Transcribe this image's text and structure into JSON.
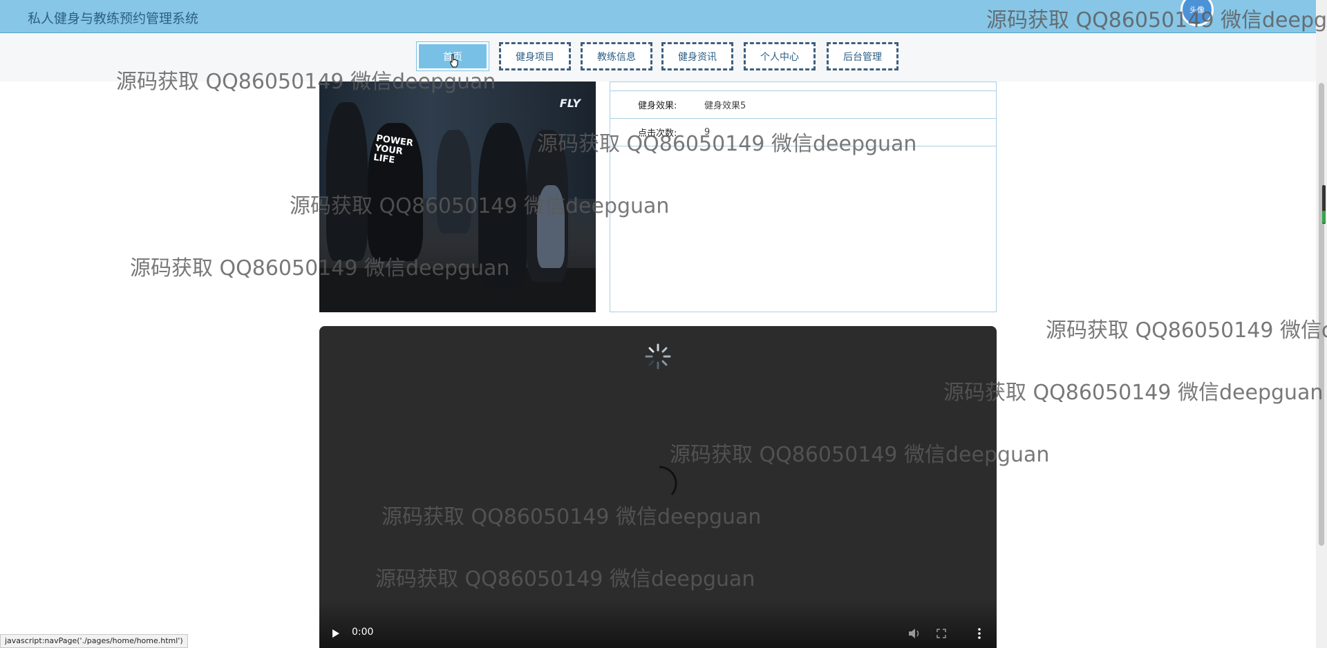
{
  "header": {
    "app_title": "私人健身与教练预约管理系统",
    "avatar_label": "头像"
  },
  "nav": {
    "items": [
      {
        "label": "首页",
        "active": true
      },
      {
        "label": "健身项目"
      },
      {
        "label": "教练信息"
      },
      {
        "label": "健身资讯"
      },
      {
        "label": "个人中心"
      },
      {
        "label": "后台管理"
      }
    ]
  },
  "detail": {
    "photo_logo": "FLY",
    "photo_shirt": "POWER YOUR LIFE",
    "fields": [
      {
        "label": "健身效果:",
        "value": "健身效果5"
      },
      {
        "label": "点击次数:",
        "value": "9"
      }
    ]
  },
  "video": {
    "time": "0:00"
  },
  "status_bar": "javascript:navPage('./pages/home/home.html')",
  "watermark": "源码获取 QQ86050149 微信deepguan",
  "watermark_cut_1": "源码获取 QQ86050149 微信deepgu",
  "watermark_cut_2": "源码获取 QQ86050149 微信d",
  "colors": {
    "header_bg": "#87c6e6",
    "nav_active": "#79c0e6",
    "nav_border": "#3f5f7d",
    "video_bg": "#2c2c2c"
  }
}
